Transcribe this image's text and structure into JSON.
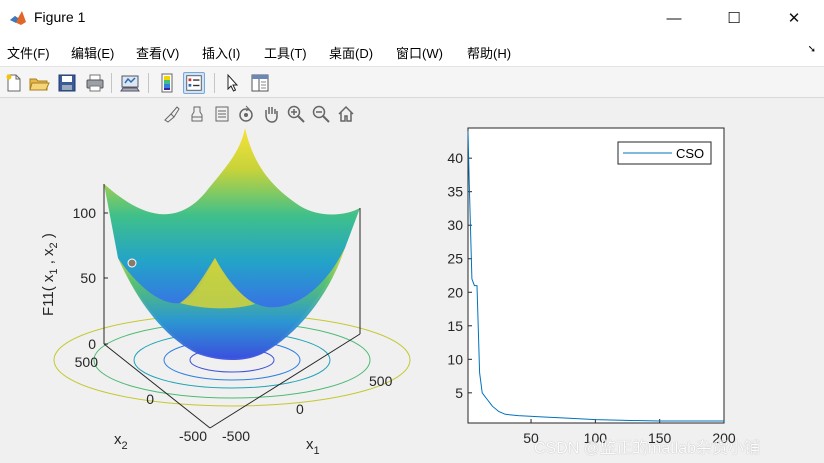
{
  "window": {
    "title": "Figure 1",
    "minimize_icon": "—",
    "maximize_icon": "☐",
    "close_icon": "✕"
  },
  "menu": {
    "items": [
      "文件(F)",
      "编辑(E)",
      "查看(V)",
      "插入(I)",
      "工具(T)",
      "桌面(D)",
      "窗口(W)",
      "帮助(H)"
    ],
    "arrow": "➘"
  },
  "toolbar": {
    "icons": [
      "new-figure-icon",
      "open-file-icon",
      "save-icon",
      "print-icon",
      "link-plot-icon",
      "colorbar-icon",
      "legend-icon",
      "pointer-icon",
      "property-inspector-icon"
    ]
  },
  "axes_toolbar": {
    "icons": [
      "brush-icon",
      "data-tips-icon",
      "edit-plot-icon",
      "rotate-3d-icon",
      "pan-icon",
      "zoom-in-icon",
      "zoom-out-icon",
      "home-icon"
    ]
  },
  "surface_plot": {
    "zlabel": "F11( x_1 , x_2 )",
    "zlabel_main": "F11( x",
    "zlabel_sub1": "1",
    "zlabel_mid": " , x",
    "zlabel_sub2": "2",
    "zlabel_end": " )",
    "x1_label": "x",
    "x1_sub": "1",
    "x2_label": "x",
    "x2_sub": "2",
    "z_ticks": [
      "0",
      "50",
      "100"
    ],
    "x2_ticks": [
      "500",
      "0",
      "-500"
    ],
    "x1_ticks": [
      "-500",
      "0",
      "500"
    ]
  },
  "chart_data": {
    "type": "line",
    "series": [
      {
        "name": "CSO",
        "color": "#0072bd",
        "x": [
          1,
          2,
          4,
          6,
          8,
          10,
          12,
          14,
          16,
          18,
          20,
          25,
          30,
          40,
          60,
          80,
          100,
          120,
          150,
          200
        ],
        "y": [
          44,
          36,
          22,
          21,
          21,
          8,
          5,
          4.5,
          4,
          3.5,
          3,
          2.2,
          1.8,
          1.6,
          1.4,
          1.2,
          1.0,
          0.9,
          0.8,
          0.8
        ]
      }
    ],
    "xlim": [
      1,
      200
    ],
    "ylim": [
      0.5,
      44.5
    ],
    "xticks": [
      50,
      100,
      150,
      200
    ],
    "yticks": [
      5,
      10,
      15,
      20,
      25,
      30,
      35,
      40
    ],
    "legend_position": "top-right",
    "grid": false
  },
  "watermark": "CSDN @监正的matlab杂货小铺"
}
